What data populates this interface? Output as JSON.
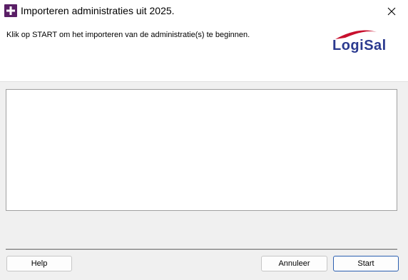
{
  "window": {
    "title": "Importeren administraties uit 2025.",
    "close_icon": "close-icon",
    "app_icon": "app-icon"
  },
  "header": {
    "instruction": "Klik op START om het importeren van de administratie(s) te beginnen.",
    "logo_text": "LogiSal",
    "logo_colors": {
      "text": "#2b3a8f",
      "swoosh": "#c8102e"
    }
  },
  "log": {
    "content": ""
  },
  "buttons": {
    "help": "Help",
    "cancel": "Annuleer",
    "start": "Start"
  }
}
